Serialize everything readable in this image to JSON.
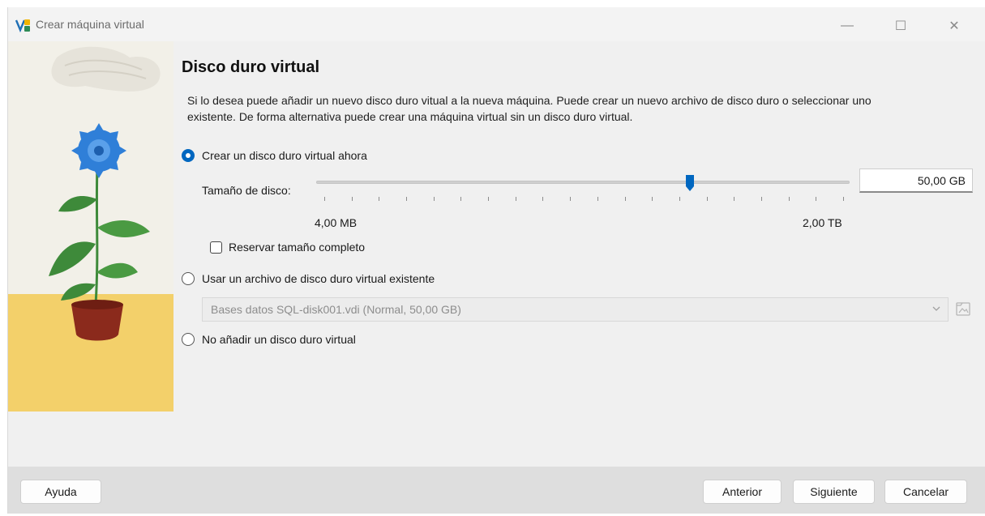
{
  "window": {
    "title": "Crear máquina virtual",
    "controls": {
      "minimize": "—",
      "maximize": "☐",
      "close": "✕"
    }
  },
  "page": {
    "heading": "Disco duro virtual",
    "description": "Si lo desea puede añadir un nuevo disco duro vitual a la nueva máquina. Puede crear un nuevo archivo de disco duro o seleccionar uno existente. De forma alternativa puede crear una máquina virtual sin un disco duro virtual."
  },
  "options": {
    "create_new": {
      "label": "Crear un disco duro virtual ahora",
      "selected": true
    },
    "use_existing": {
      "label": "Usar un archivo de disco duro virtual existente",
      "selected": false
    },
    "no_disk": {
      "label": "No añadir un disco duro virtual",
      "selected": false
    }
  },
  "disk_size": {
    "label": "Tamaño de disco:",
    "value": "50,00 GB",
    "min_label": "4,00 MB",
    "max_label": "2,00 TB",
    "slider_fraction": 0.7,
    "tick_count": 20
  },
  "preallocate": {
    "label": "Reservar tamaño completo",
    "checked": false
  },
  "existing_file": {
    "selected": "Bases datos SQL-disk001.vdi (Normal, 50,00 GB)"
  },
  "buttons": {
    "help": "Ayuda",
    "back": "Anterior",
    "next": "Siguiente",
    "cancel": "Cancelar"
  },
  "colors": {
    "accent": "#0067c0",
    "window_bg": "#f0f0f0",
    "footer_bg": "#dedede",
    "illustration_bg": "#f2f0e8",
    "illustration_floor": "#f3d06a",
    "flower": "#2f7fd8",
    "leaves": "#3e8a3a",
    "pot": "#8b2a1c"
  }
}
